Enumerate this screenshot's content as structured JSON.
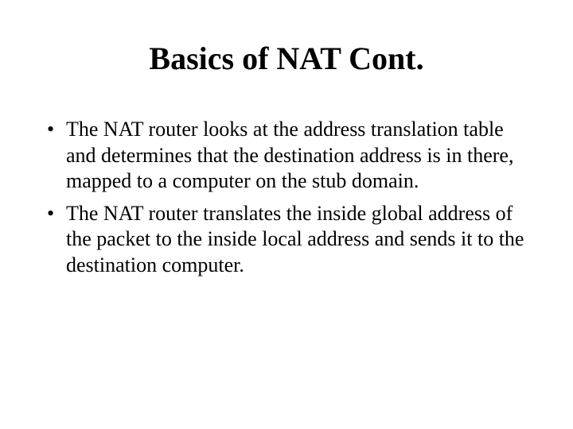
{
  "title": "Basics of NAT Cont.",
  "bullets": [
    "The NAT router looks at the address translation table and determines that the destination address is in there, mapped to a computer on the stub domain.",
    "The NAT router translates the inside global address of the packet to the inside local address and sends it to the destination computer."
  ]
}
